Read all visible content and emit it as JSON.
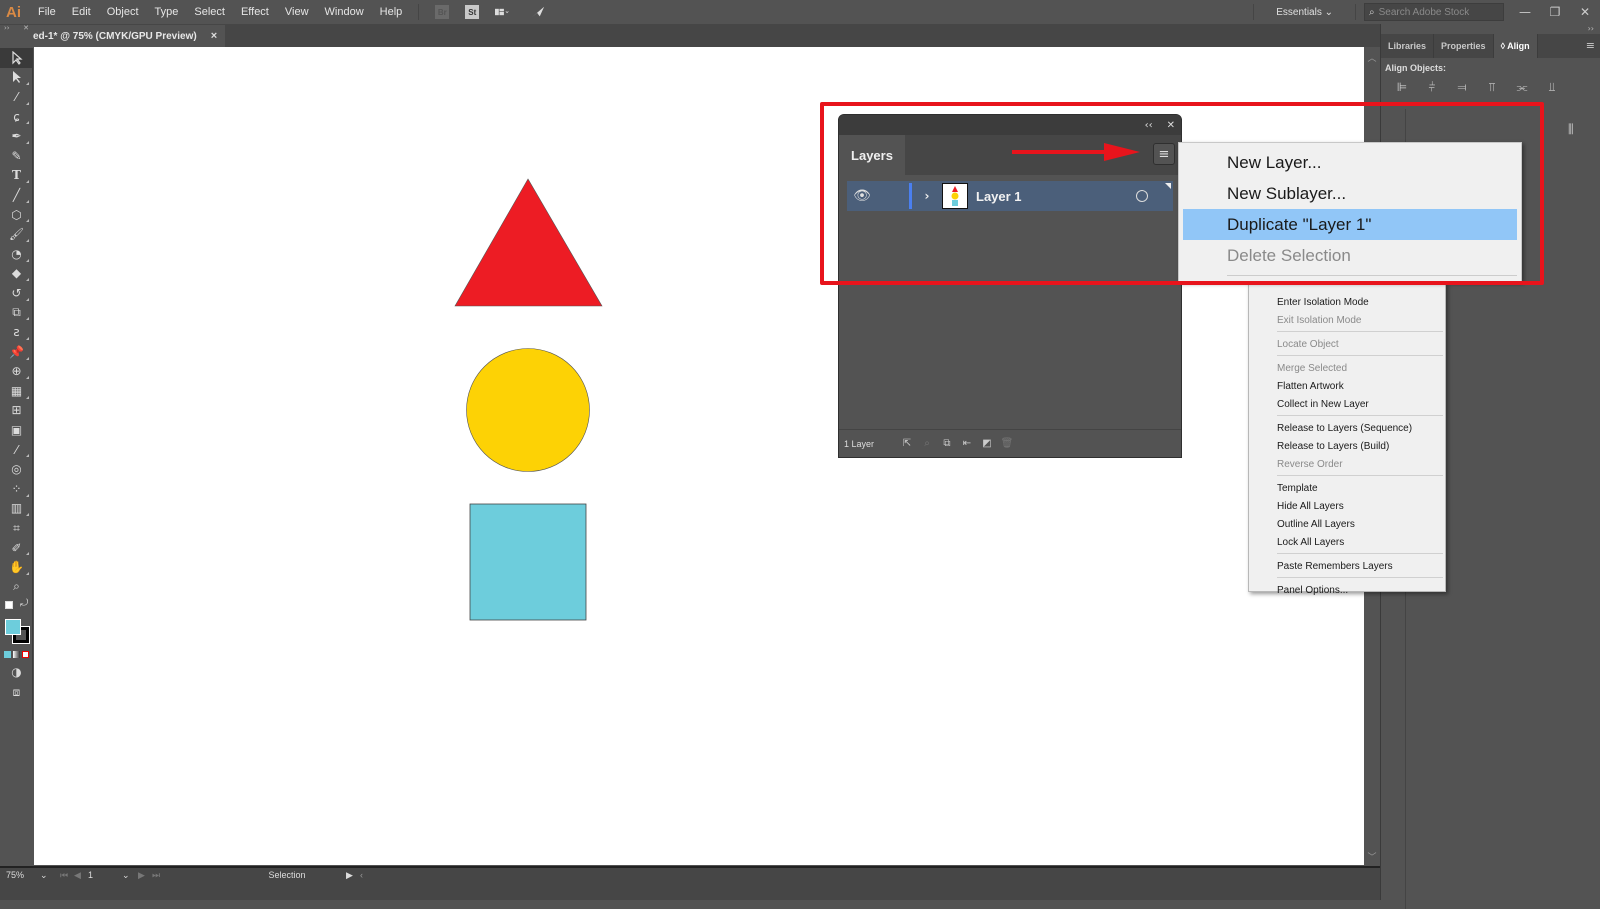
{
  "app": {
    "logo": "Ai",
    "menu": [
      "File",
      "Edit",
      "Object",
      "Type",
      "Select",
      "Effect",
      "View",
      "Window",
      "Help"
    ],
    "toolbar_icons": [
      "bridge-icon",
      "stock-icon",
      "arrange-documents-icon",
      "gpu-performance-icon"
    ],
    "bridge_label": "Br",
    "stock_label": "St",
    "workspace": "Essentials",
    "search_placeholder": "Search Adobe Stock",
    "window_controls": {
      "minimize": "—",
      "restore": "❐",
      "close": "✕"
    }
  },
  "document": {
    "tab_title": "ed-1* @ 75% (CMYK/GPU Preview)",
    "tab_close": "×"
  },
  "canvas": {
    "shapes": [
      {
        "type": "triangle",
        "fill": "#ed1c24"
      },
      {
        "type": "circle",
        "fill": "#fdd205"
      },
      {
        "type": "square",
        "fill": "#6dcddc"
      }
    ]
  },
  "right_panel": {
    "tabs": [
      "Libraries",
      "Properties",
      "◊ Align"
    ],
    "active_tab": "Align",
    "section_label": "Align Objects:"
  },
  "layers_panel": {
    "title": "Layers",
    "collapse": "‹‹",
    "close": "✕",
    "layers": [
      {
        "name": "Layer 1",
        "visible": true,
        "color": "#4a7ff0"
      }
    ],
    "footer_count": "1 Layer"
  },
  "flyout_menu": {
    "top_items": [
      {
        "label": "New Layer...",
        "enabled": true,
        "highlighted": false
      },
      {
        "label": "New Sublayer...",
        "enabled": true,
        "highlighted": false
      },
      {
        "label": "Duplicate \"Layer 1\"",
        "enabled": true,
        "highlighted": true
      },
      {
        "label": "Delete Selection",
        "enabled": false,
        "highlighted": false
      }
    ],
    "groups": [
      [
        {
          "label": "Enter Isolation Mode",
          "enabled": true
        },
        {
          "label": "Exit Isolation Mode",
          "enabled": false
        }
      ],
      [
        {
          "label": "Locate Object",
          "enabled": false
        }
      ],
      [
        {
          "label": "Merge Selected",
          "enabled": false
        },
        {
          "label": "Flatten Artwork",
          "enabled": true
        },
        {
          "label": "Collect in New Layer",
          "enabled": true
        }
      ],
      [
        {
          "label": "Release to Layers (Sequence)",
          "enabled": true
        },
        {
          "label": "Release to Layers (Build)",
          "enabled": true
        },
        {
          "label": "Reverse Order",
          "enabled": false
        }
      ],
      [
        {
          "label": "Template",
          "enabled": true
        },
        {
          "label": "Hide All Layers",
          "enabled": true
        },
        {
          "label": "Outline All Layers",
          "enabled": true
        },
        {
          "label": "Lock All Layers",
          "enabled": true
        }
      ],
      [
        {
          "label": "Paste Remembers Layers",
          "enabled": true
        }
      ],
      [
        {
          "label": "Panel Options...",
          "enabled": true
        }
      ]
    ]
  },
  "status_bar": {
    "zoom": "75%",
    "artboard": "1",
    "tool": "Selection"
  },
  "annotation": {
    "highlight_color": "#e8141c"
  },
  "tools": [
    "selection-tool-icon",
    "direct-selection-tool-icon",
    "magic-wand-tool-icon",
    "lasso-tool-icon",
    "pen-tool-icon",
    "curvature-tool-icon",
    "type-tool-icon",
    "line-segment-tool-icon",
    "ellipse-tool-icon",
    "paintbrush-tool-icon",
    "shaper-tool-icon",
    "eraser-tool-icon",
    "rotate-tool-icon",
    "scale-tool-icon",
    "warp-tool-icon",
    "puppet-warp-tool-icon",
    "shape-builder-tool-icon",
    "perspective-grid-tool-icon",
    "mesh-tool-icon",
    "gradient-tool-icon",
    "eyedropper-tool-icon",
    "blend-tool-icon",
    "symbol-sprayer-tool-icon",
    "column-graph-tool-icon",
    "artboard-tool-icon",
    "slice-tool-icon",
    "hand-tool-icon",
    "zoom-tool-icon"
  ],
  "fill_stroke": {
    "fill": "#6dcddc",
    "stroke": "#000000"
  }
}
